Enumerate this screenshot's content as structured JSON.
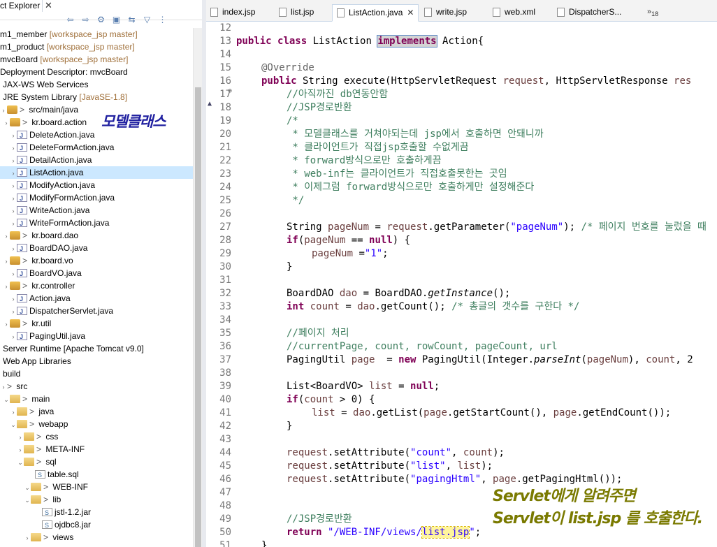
{
  "explorer": {
    "title": "ct Explorer",
    "close": "✕",
    "toolbar": [
      "⇦",
      "⇨",
      "⚙",
      "▣",
      "⇆",
      "▽",
      "⋮"
    ],
    "items": [
      {
        "label": "m1_member",
        "dec": " [workspace_jsp master]"
      },
      {
        "label": "m1_product",
        "dec": " [workspace_jsp master]"
      },
      {
        "label": "mvcBoard",
        "dec": " [workspace_jsp master]"
      },
      {
        "label": "Deployment Descriptor: mvcBoard",
        "dec": ""
      },
      {
        "label": "JAX-WS Web Services",
        "dec": ""
      },
      {
        "label": "JRE System Library",
        "dec": " [JavaSE-1.8]"
      },
      {
        "label": "src/main/java",
        "dec": "",
        "gt": "> "
      },
      {
        "label": "kr.board.action",
        "dec": "",
        "gt": "> "
      },
      {
        "label": "DeleteAction.java",
        "dec": ""
      },
      {
        "label": "DeleteFormAction.java",
        "dec": ""
      },
      {
        "label": "DetailAction.java",
        "dec": ""
      },
      {
        "label": "ListAction.java",
        "dec": ""
      },
      {
        "label": "ModifyAction.java",
        "dec": ""
      },
      {
        "label": "ModifyFormAction.java",
        "dec": ""
      },
      {
        "label": "WriteAction.java",
        "dec": ""
      },
      {
        "label": "WriteFormAction.java",
        "dec": ""
      },
      {
        "label": "kr.board.dao",
        "dec": "",
        "gt": "> "
      },
      {
        "label": "BoardDAO.java",
        "dec": ""
      },
      {
        "label": "kr.board.vo",
        "dec": "",
        "gt": "> "
      },
      {
        "label": "BoardVO.java",
        "dec": ""
      },
      {
        "label": "kr.controller",
        "dec": "",
        "gt": "> "
      },
      {
        "label": "Action.java",
        "dec": ""
      },
      {
        "label": "DispatcherServlet.java",
        "dec": ""
      },
      {
        "label": "kr.util",
        "dec": "",
        "gt": "> "
      },
      {
        "label": "PagingUtil.java",
        "dec": ""
      },
      {
        "label": "Server Runtime [Apache Tomcat v9.0]",
        "dec": ""
      },
      {
        "label": "Web App Libraries",
        "dec": ""
      },
      {
        "label": "build",
        "dec": ""
      },
      {
        "label": "src",
        "dec": "",
        "gt": "> "
      },
      {
        "label": "main",
        "dec": "",
        "gt": "> "
      },
      {
        "label": "java",
        "dec": "",
        "gt": "> "
      },
      {
        "label": "webapp",
        "dec": "",
        "gt": "> "
      },
      {
        "label": "css",
        "dec": "",
        "gt": "> "
      },
      {
        "label": "META-INF",
        "dec": "",
        "gt": "> "
      },
      {
        "label": "sql",
        "dec": "",
        "gt": "> "
      },
      {
        "label": "table.sql",
        "dec": ""
      },
      {
        "label": "WEB-INF",
        "dec": "",
        "gt": "> "
      },
      {
        "label": "lib",
        "dec": "",
        "gt": "> "
      },
      {
        "label": "jstl-1.2.jar",
        "dec": ""
      },
      {
        "label": "ojdbc8.jar",
        "dec": ""
      },
      {
        "label": "views",
        "dec": "",
        "gt": "> "
      }
    ],
    "note": "모델클래스"
  },
  "tabs": [
    {
      "label": "index.jsp"
    },
    {
      "label": "list.jsp"
    },
    {
      "label": "ListAction.java",
      "close": "✕"
    },
    {
      "label": "write.jsp"
    },
    {
      "label": "web.xml"
    },
    {
      "label": "DispatcherS..."
    }
  ],
  "tab_more": "»",
  "tab_more_count": "18",
  "line_numbers": [
    "12",
    "13",
    "14",
    "15",
    "16",
    "17",
    "18",
    "19",
    "20",
    "21",
    "22",
    "23",
    "24",
    "25",
    "26",
    "27",
    "28",
    "29",
    "30",
    "31",
    "32",
    "33",
    "34",
    "35",
    "36",
    "37",
    "38",
    "39",
    "40",
    "41",
    "42",
    "43",
    "44",
    "45",
    "46",
    "47",
    "48",
    "49",
    "50",
    "51"
  ],
  "code": {
    "public_kw": "public",
    "class_kw": "class",
    "class_name": " ListAction ",
    "implements_kw": "implements",
    "action_iface": " Action{",
    "override": "@Override",
    "exec_sig": " String execute(HttpServletRequest ",
    "req_var": "request",
    "exec_sig2": ", HttpServletResponse ",
    "resp_var": "res",
    "c17": "//아직까진 db연동안함",
    "c18": "//JSP경로반환",
    "c19": "/*",
    "c20": " * 모델클래스를 거쳐야되는데 jsp에서 호출하면 안돼니까",
    "c21": " * 클라이언트가 직접jsp호출할 수없게끔",
    "c22": " * forward방식으로만 호출하게끔",
    "c23": " * web-inf는 클라이언트가 직접호출못한는 곳임",
    "c24": " * 이제그럼 forward방식으로만 호출하게만 설정해준다",
    "c25": " */",
    "l27a": "String ",
    "l27v": "pageNum",
    "l27b": " = ",
    "l27c": ".getParameter(",
    "l27s": "\"pageNum\"",
    "l27d": "); ",
    "l27cm": "/* 페이지 번호를 눌렀을 때",
    "if_kw": "if",
    "l28a": "(",
    "l28b": " == ",
    "null_kw": "null",
    "l28c": ") {",
    "l29b": " =",
    "l29s": "\"1\"",
    "l29c": ";",
    "brace_close": "}",
    "l32a": "BoardDAO ",
    "l32v": "dao",
    "l32b": " = BoardDAO.",
    "l32i": "getInstance",
    "l32c": "();",
    "int_kw": "int",
    "l33v": "count",
    "l33b": " = ",
    "l33c": ".getCount(); ",
    "l33cm": "/* 총글의 갯수를 구한다 */",
    "c35": "//페이지 처리",
    "c36": "//currentPage, count, rowCount, pageCount, url",
    "l37a": "PagingUtil ",
    "l37v": "page",
    "l37b": "  = ",
    "new_kw": "new",
    "l37c": " PagingUtil(Integer.",
    "l37i": "parseInt",
    "l37d": "(",
    "l37e": "), ",
    "l37f": ", 2",
    "l39a": "List<BoardVO> ",
    "l39v": "list",
    "l39b": " = ",
    "l39c": ";",
    "l40b": " > 0) {",
    "l41b": " = ",
    "l41c": ".getList(",
    "l41d": ".getStartCount(), ",
    "l41e": ".getEndCount());",
    "l44a": ".setAttribute(",
    "l44s": "\"count\"",
    "l44b": ", ",
    "l44c": ");",
    "l45s": "\"list\"",
    "l46s": "\"pagingHtml\"",
    "l46c": ".getPagingHtml());",
    "c49": "//JSP경로반환",
    "return_kw": "return",
    "l50s1": " \"/WEB-INF/views/",
    "l50s2": "list.jsp",
    "l50s3": "\"",
    "l50c": ";"
  },
  "note2": [
    "Servlet에게 알려주면",
    "Servlet이 list.jsp 를 호출한다."
  ]
}
